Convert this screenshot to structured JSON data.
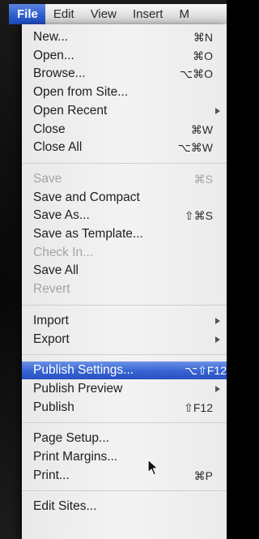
{
  "menubar": {
    "items": [
      {
        "label": "File",
        "active": true
      },
      {
        "label": "Edit"
      },
      {
        "label": "View"
      },
      {
        "label": "Insert"
      },
      {
        "label": "M"
      }
    ]
  },
  "file_menu": {
    "groups": [
      [
        {
          "label": "New...",
          "shortcut": "⌘N"
        },
        {
          "label": "Open...",
          "shortcut": "⌘O"
        },
        {
          "label": "Browse...",
          "shortcut": "⌥⌘O"
        },
        {
          "label": "Open from Site..."
        },
        {
          "label": "Open Recent",
          "submenu": true
        },
        {
          "label": "Close",
          "shortcut": "⌘W"
        },
        {
          "label": "Close All",
          "shortcut": "⌥⌘W"
        }
      ],
      [
        {
          "label": "Save",
          "shortcut": "⌘S",
          "disabled": true
        },
        {
          "label": "Save and Compact"
        },
        {
          "label": "Save As...",
          "shortcut": "⇧⌘S"
        },
        {
          "label": "Save as Template..."
        },
        {
          "label": "Check In...",
          "disabled": true
        },
        {
          "label": "Save All"
        },
        {
          "label": "Revert",
          "disabled": true
        }
      ],
      [
        {
          "label": "Import",
          "submenu": true
        },
        {
          "label": "Export",
          "submenu": true
        }
      ],
      [
        {
          "label": "Publish Settings...",
          "shortcut": "⌥⇧F12",
          "highlighted": true
        },
        {
          "label": "Publish Preview",
          "submenu": true
        },
        {
          "label": "Publish",
          "shortcut": "⇧F12"
        }
      ],
      [
        {
          "label": "Page Setup..."
        },
        {
          "label": "Print Margins..."
        },
        {
          "label": "Print...",
          "shortcut": "⌘P"
        }
      ],
      [
        {
          "label": "Edit Sites..."
        }
      ]
    ]
  },
  "colors": {
    "highlight": "#3a67d4",
    "menu_background": "#efefef",
    "disabled_text": "#a4a4a4"
  },
  "icons": {
    "cursor": "arrow-cursor-icon",
    "submenu": "submenu-arrow-icon"
  }
}
